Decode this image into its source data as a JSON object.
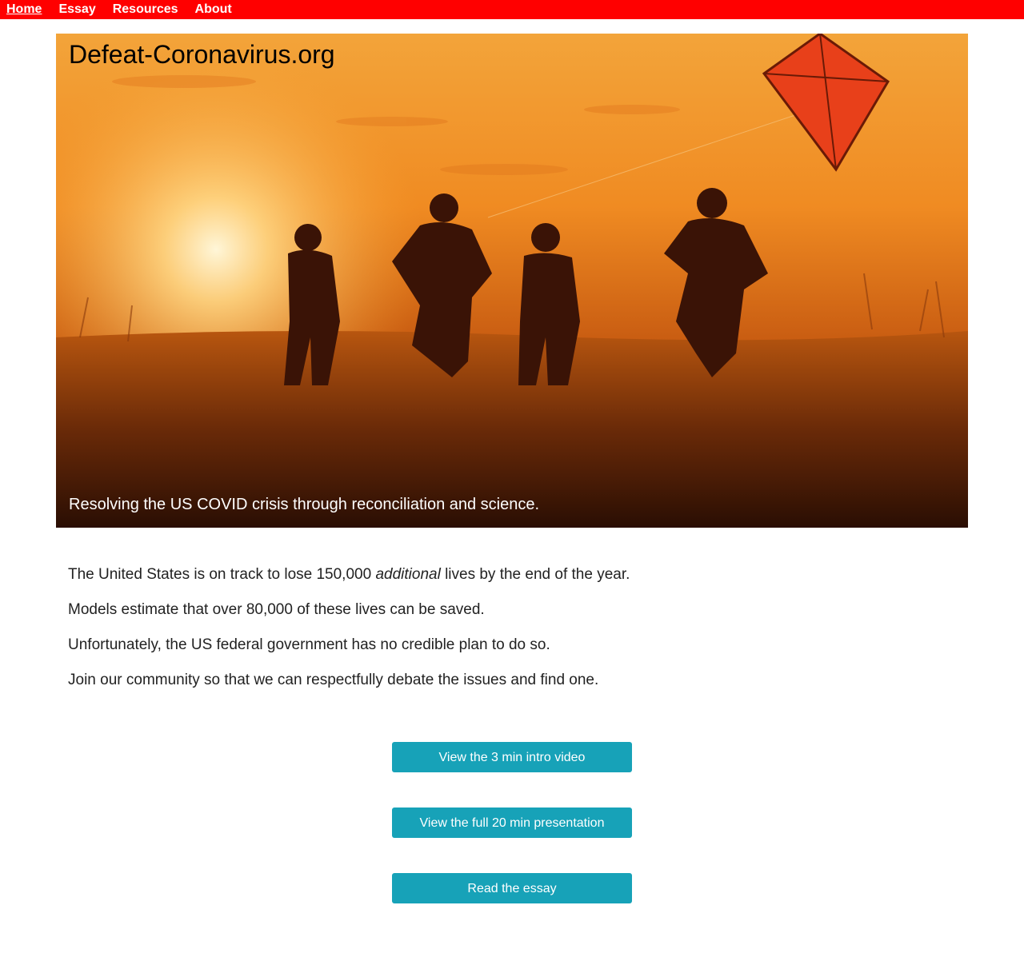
{
  "nav": {
    "items": [
      "Home",
      "Essay",
      "Resources",
      "About"
    ],
    "active": "Home"
  },
  "hero": {
    "title": "Defeat-Coronavirus.org",
    "tagline": "Resolving the US COVID crisis through reconciliation and science.",
    "image_description": "children-running-with-kite-at-sunset"
  },
  "content": {
    "line1_before": "The United States is on track to lose 150,000 ",
    "line1_emphasis": "additional",
    "line1_after": " lives by the end of the year.",
    "line2": "Models estimate that over 80,000 of these lives can be saved.",
    "line3": "Unfortunately, the US federal government has no credible plan to do so.",
    "line4": "Join our community so that we can respectfully debate the issues and find one."
  },
  "buttons": {
    "intro_video": "View the 3 min intro video",
    "full_presentation": "View the full 20 min presentation",
    "read_essay": "Read the essay"
  },
  "colors": {
    "nav_bg": "#ff0000",
    "button_bg": "#17a2b8"
  }
}
